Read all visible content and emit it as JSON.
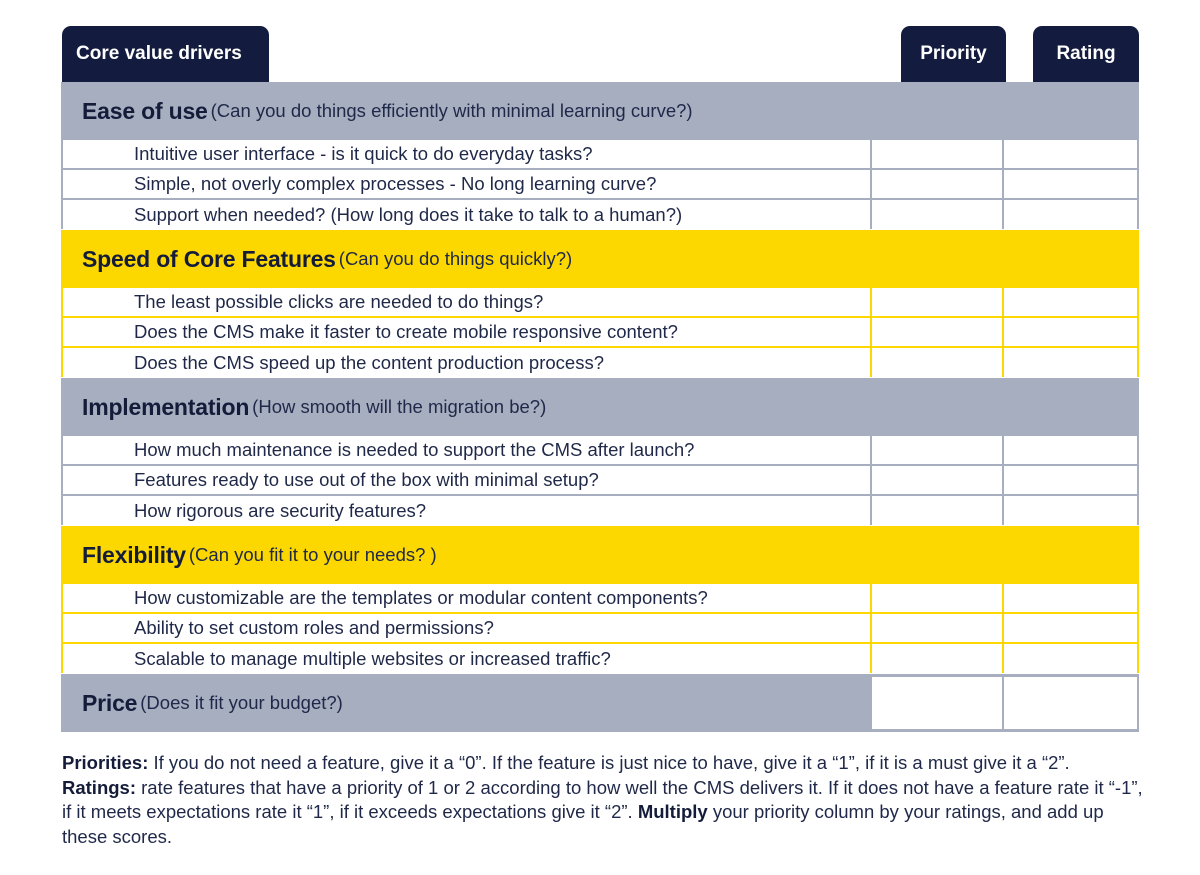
{
  "header": {
    "core_label": "Core value drivers",
    "priority_label": "Priority",
    "rating_label": "Rating"
  },
  "colors": {
    "navy": "#131c3f",
    "grey_band": "#a6aec0",
    "yellow_band": "#fdd800"
  },
  "sections": [
    {
      "title": "Ease of use",
      "subtitle": "(Can you do things efficiently with minimal learning curve?)",
      "theme": "grey",
      "items": [
        "Intuitive user interface - is it quick to do everyday tasks?",
        "Simple, not overly complex processes - No long learning curve?",
        "Support when needed? (How long does it take to talk to a human?)"
      ]
    },
    {
      "title": "Speed of Core Features",
      "subtitle": "(Can you do things quickly?)",
      "theme": "yellow",
      "items": [
        "The least possible clicks are needed to do things?",
        "Does the CMS make it faster to create mobile responsive content?",
        "Does the CMS speed up the content production process?"
      ]
    },
    {
      "title": "Implementation",
      "subtitle": "(How smooth will the migration be?)",
      "theme": "grey",
      "items": [
        "How much maintenance is needed to support the CMS after launch?",
        "Features ready to use out of the box with minimal setup?",
        "How rigorous are security features?"
      ]
    },
    {
      "title": "Flexibility",
      "subtitle": "(Can you fit it to your needs? )",
      "theme": "yellow",
      "items": [
        "How customizable are the templates or modular content components?",
        "Ability to set custom roles and permissions?",
        "Scalable to manage multiple websites or increased traffic?"
      ]
    }
  ],
  "price": {
    "title": "Price",
    "subtitle": "(Does it fit your budget?)"
  },
  "footer": {
    "priorities_label": "Priorities:",
    "priorities_text": " If you do not need a feature, give it a “0”. If the feature is just nice to have, give it a “1”, if it is a must give it a “2”. ",
    "ratings_label": "Ratings:",
    "ratings_text": " rate features that have a priority of 1 or 2 according to how well the CMS delivers it. If it does not have a feature rate it “-1”, if it meets expectations rate it “1”, if it exceeds expectations give it “2”. ",
    "multiply_label": "Multiply",
    "multiply_text": " your priority column by your ratings, and add up these scores."
  }
}
